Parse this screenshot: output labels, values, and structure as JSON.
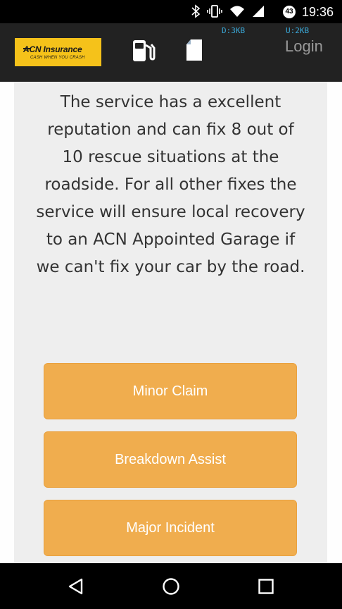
{
  "status_bar": {
    "time": "19:36",
    "badge": "43",
    "icons": [
      "bluetooth-icon",
      "vibrate-icon",
      "wifi-icon",
      "signal-icon"
    ]
  },
  "header": {
    "logo": {
      "title": "ACN Insurance",
      "tagline": "CASH WHEN YOU CRASH"
    },
    "network": {
      "download": "D:3KB",
      "upload": "U:2KB"
    },
    "login_label": "Login",
    "icons": [
      "fuel-pump-icon",
      "document-icon"
    ]
  },
  "main": {
    "description": "The service has a excellent reputation and can fix 8 out of 10 rescue situations at the roadside. For all other fixes the service will ensure local recovery to an ACN Appointed Garage if we can't fix your car by the road.",
    "buttons": [
      {
        "label": "Minor Claim"
      },
      {
        "label": "Breakdown Assist"
      },
      {
        "label": "Major Incident"
      }
    ]
  },
  "nav_bar": {
    "icons": [
      "back-icon",
      "home-icon",
      "recents-icon"
    ]
  },
  "colors": {
    "button": "#f0ad4e",
    "header": "#222222",
    "logo_bg": "#f5c21a",
    "content_bg": "#eeeeee"
  }
}
